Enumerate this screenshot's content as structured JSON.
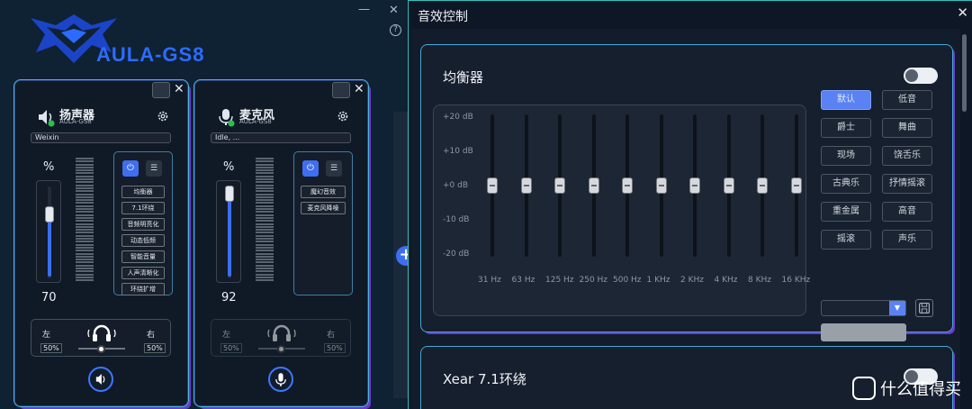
{
  "main_window": {
    "app_title": "AULA-GS8",
    "speaker": {
      "name": "扬声器",
      "model": "AULA-GS8",
      "app": "Weixin",
      "percent_sign": "%",
      "volume": "70",
      "volume_level": 0.7,
      "effects": [
        "均衡器",
        "7.1环绕",
        "音频明亮化",
        "动态低频",
        "智能音量",
        "人声清晰化",
        "环绕扩增"
      ],
      "balance_left_label": "左",
      "balance_right_label": "右",
      "balance_left": "50%",
      "balance_right": "50%"
    },
    "mic": {
      "name": "麦克风",
      "model": "AULA-GS8",
      "app": "Idle, ...",
      "percent_sign": "%",
      "volume": "92",
      "volume_level": 0.92,
      "effects": [
        "魔幻音效",
        "麦克风降噪"
      ],
      "balance_left_label": "左",
      "balance_right_label": "右",
      "balance_left": "50%",
      "balance_right": "50%"
    }
  },
  "fx_window": {
    "title": "音效控制",
    "equalizer": {
      "title": "均衡器",
      "db_labels": [
        "+20 dB",
        "+10 dB",
        "+0 dB",
        "-10 dB",
        "-20 dB"
      ],
      "bands": [
        "31 Hz",
        "63 Hz",
        "125 Hz",
        "250 Hz",
        "500 Hz",
        "1 KHz",
        "2 KHz",
        "4 KHz",
        "8 KHz",
        "16 KHz"
      ],
      "band_values_db": [
        0,
        0,
        0,
        0,
        0,
        0,
        0,
        0,
        0,
        0
      ],
      "presets": [
        "默认",
        "低音",
        "爵士",
        "舞曲",
        "现场",
        "饶舌乐",
        "古典乐",
        "抒情摇滚",
        "重金属",
        "高音",
        "摇滚",
        "声乐"
      ],
      "active_preset": "默认"
    },
    "surround": {
      "title": "Xear 7.1环绕"
    }
  },
  "watermark": "什么值得买",
  "colors": {
    "accent": "#3c6ef0",
    "border": "#46a9d6",
    "glow": "#6b3bd0"
  }
}
